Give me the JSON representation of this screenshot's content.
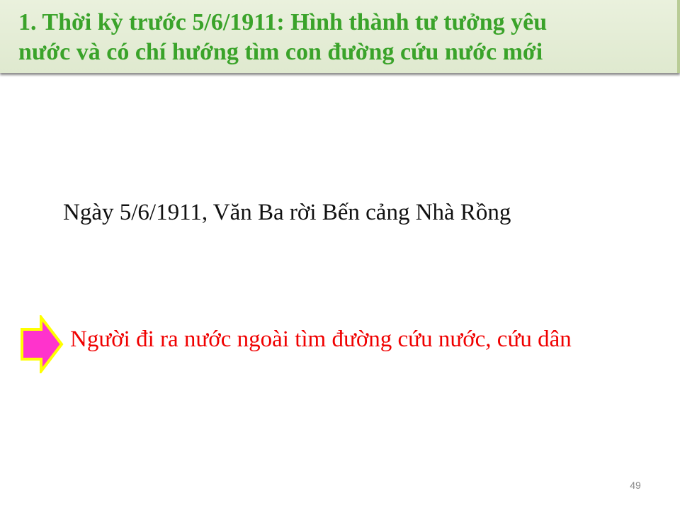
{
  "title": {
    "line1": "1. Thời kỳ trước 5/6/1911: Hình thành tư tưởng yêu",
    "line2": "nước và có chí hướng tìm con đường cứu nước mới"
  },
  "body": {
    "fact": "Ngày 5/6/1911, Văn Ba rời Bến cảng Nhà Rồng",
    "result": "Người đi ra nước ngoài tìm đường cứu nước, cứu dân"
  },
  "footer": {
    "page_number": "49"
  },
  "colors": {
    "title_text": "#3aa32a",
    "title_background": "#eaf1dd",
    "arrow_fill": "#ff33cc",
    "arrow_outline": "#ffff00",
    "result_text": "#f00000"
  },
  "icons": {
    "arrow": "right-arrow-icon"
  }
}
